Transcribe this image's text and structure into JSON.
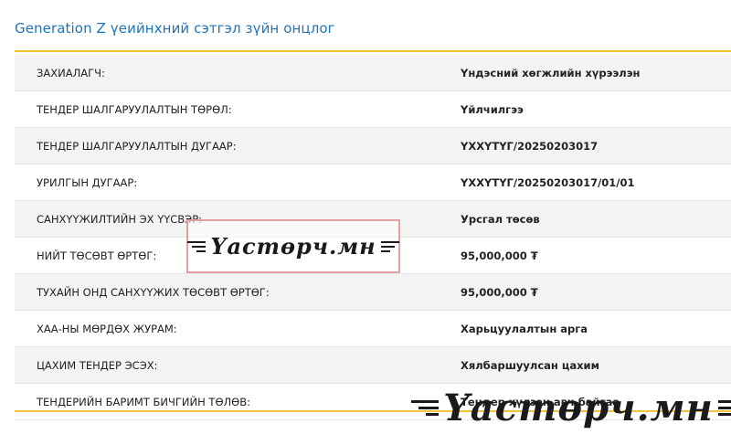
{
  "title": "Generation Z үеийнхний сэтгэл зүйн онцлог",
  "rows": [
    {
      "label": "ЗАХИАЛАГЧ:",
      "value": "Үндэсний хөгжлийн хүрээлэн"
    },
    {
      "label": "ТЕНДЕР ШАЛГАРУУЛАЛТЫН ТӨРӨЛ:",
      "value": "Үйлчилгээ"
    },
    {
      "label": "ТЕНДЕР ШАЛГАРУУЛАЛТЫН ДУГААР:",
      "value": "ҮХХҮТҮГ/20250203017"
    },
    {
      "label": "УРИЛГЫН ДУГААР:",
      "value": "ҮХХҮТҮГ/20250203017/01/01"
    },
    {
      "label": "САНХҮҮЖИЛТИЙН ЭХ ҮҮСВЭР:",
      "value": "Урсгал төсөв"
    },
    {
      "label": "НИЙТ ТӨСӨВТ ӨРТӨГ:",
      "value": "95,000,000 ₮"
    },
    {
      "label": "ТУХАЙН ОНД САНХҮҮЖИХ ТӨСӨВТ ӨРТӨГ:",
      "value": "95,000,000 ₮"
    },
    {
      "label": "ХАА-НЫ МӨРДӨХ ЖУРАМ:",
      "value": "Харьцуулалтын арга"
    },
    {
      "label": "ЦАХИМ ТЕНДЕР ЭСЭХ:",
      "value": "Хялбаршуулсан цахим"
    },
    {
      "label": "ТЕНДЕРИЙН БАРИМТ БИЧГИЙН ТӨЛӨВ:",
      "value": "Тендер хүлээн авч байгаа"
    }
  ],
  "watermark_small": "Үастөрч.мн",
  "watermark_large": "Үастөрч.мн",
  "colors": {
    "title": "#1f74b8",
    "accent_rule": "#f2c23a",
    "row_alt": "#f3f3f3"
  }
}
